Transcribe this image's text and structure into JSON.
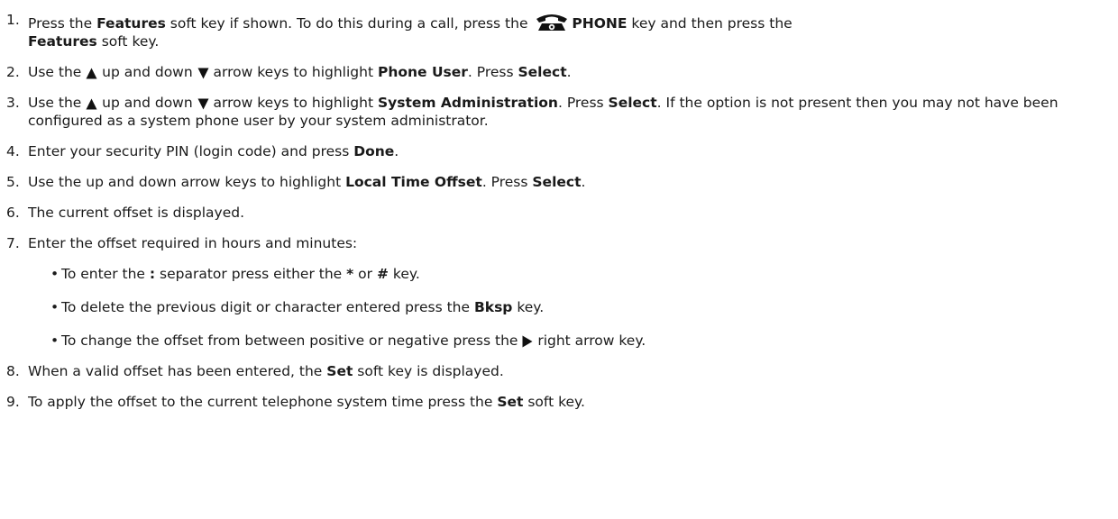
{
  "steps": [
    {
      "num": "1.",
      "t0": "Press the ",
      "b0": "Features",
      "t1": " soft key if shown. To do this during a call, press the ",
      "icon": "phone-icon",
      "b1": "PHONE",
      "t2": " key and then press the ",
      "b2": "Features",
      "t3": " soft key."
    },
    {
      "num": "2.",
      "t0": "Use the ",
      "icon_up": "up-arrow-icon",
      "t1": " up and down ",
      "icon_down": "down-arrow-icon",
      "t2": " arrow keys to highlight ",
      "b0": "Phone User",
      "t3": ". Press ",
      "b1": "Select",
      "t4": "."
    },
    {
      "num": "3.",
      "t0": "Use the ",
      "icon_up": "up-arrow-icon",
      "t1": " up and down ",
      "icon_down": "down-arrow-icon",
      "t2": " arrow keys to highlight ",
      "b0": "System Administration",
      "t3": ". Press ",
      "b1": "Select",
      "t4": ". If the option is not present then you may not have been configured as a system phone user by your system administrator."
    },
    {
      "num": "4.",
      "t0": "Enter your security PIN (login code) and press ",
      "b0": "Done",
      "t1": "."
    },
    {
      "num": "5.",
      "t0": "Use the up and down arrow keys to highlight ",
      "b0": "Local Time Offset",
      "t1": ". Press ",
      "b1": "Select",
      "t2": "."
    },
    {
      "num": "6.",
      "t0": "The current offset is displayed."
    },
    {
      "num": "7.",
      "t0": "Enter the offset required in hours and minutes:",
      "bullets": [
        {
          "t0": "To enter the ",
          "b0": ":",
          "t1": " separator press either the ",
          "b1": "*",
          "t2": " or ",
          "b2": "#",
          "t3": " key."
        },
        {
          "t0": "To delete the previous digit or character entered press the ",
          "b0": "Bksp",
          "t1": " key."
        },
        {
          "t0": "To change the offset from between positive or negative press the ",
          "icon_right": "right-arrow-icon",
          "t1": " right arrow key."
        }
      ]
    },
    {
      "num": "8.",
      "t0": "When a valid offset has been entered, the ",
      "b0": "Set",
      "t1": " soft key is displayed."
    },
    {
      "num": "9.",
      "t0": "To apply the offset to the current telephone system time press the ",
      "b0": "Set",
      "t1": " soft key."
    }
  ],
  "bullet_char": "•"
}
